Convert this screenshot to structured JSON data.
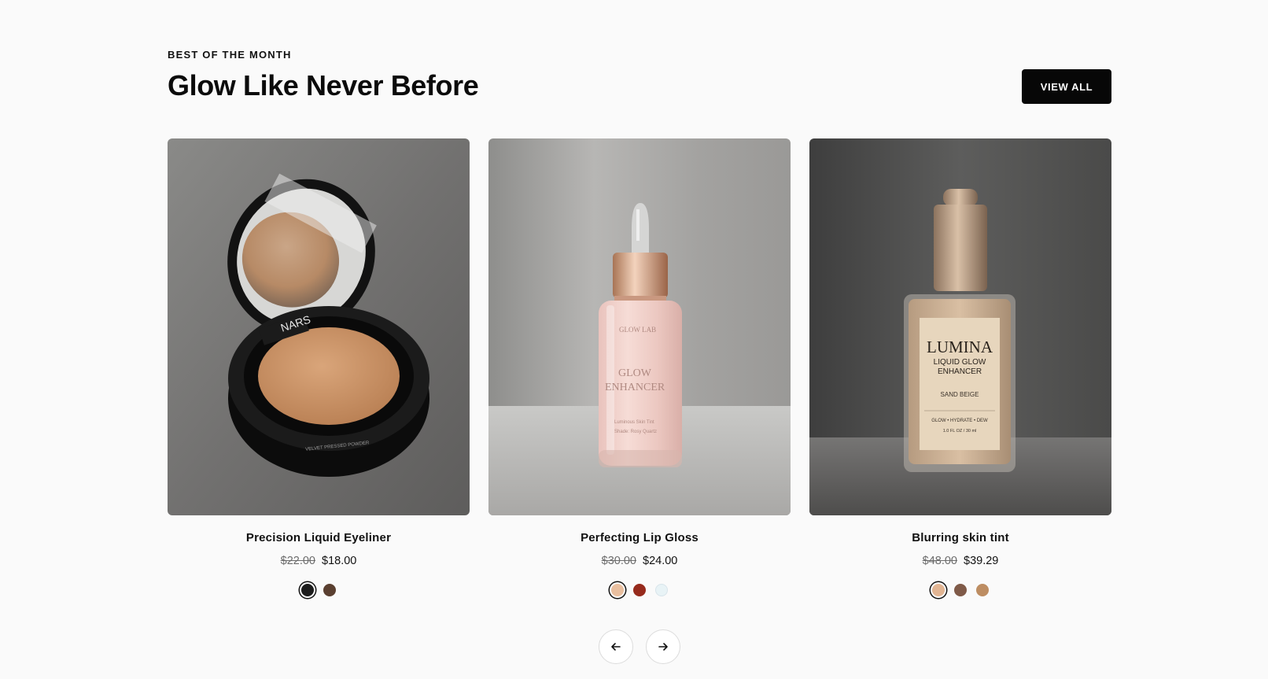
{
  "header": {
    "eyebrow": "BEST OF THE MONTH",
    "title": "Glow Like Never Before",
    "view_all_label": "VIEW ALL"
  },
  "products": [
    {
      "name": "Precision Liquid Eyeliner",
      "old_price": "$22.00",
      "price": "$18.00",
      "image_label": "NARS",
      "image_caption": "VELVET PRESSED POWDER",
      "swatches": [
        "#1c1c1c",
        "#5a3f30"
      ],
      "active_swatch": 0
    },
    {
      "name": "Perfecting Lip Gloss",
      "old_price": "$30.00",
      "price": "$24.00",
      "image_label": "GLOW LAB",
      "image_caption": "GLOW ENHANCER",
      "swatches": [
        "#e9bf9f",
        "#962a1c",
        "#e8f3f6"
      ],
      "active_swatch": 0
    },
    {
      "name": "Blurring skin tint",
      "old_price": "$48.00",
      "price": "$39.29",
      "image_label": "LUMINA",
      "image_caption": "LIQUID GLOW ENHANCER",
      "image_detail": "SAND BEIGE",
      "image_tagline": "GLOW • HYDRATE • DEW",
      "image_size": "1.0 FL OZ / 30 ml",
      "swatches": [
        "#e2b593",
        "#7f5a48",
        "#bd8d62"
      ],
      "active_swatch": 0
    }
  ],
  "carousel": {
    "prev_icon": "arrow-left-icon",
    "next_icon": "arrow-right-icon"
  }
}
